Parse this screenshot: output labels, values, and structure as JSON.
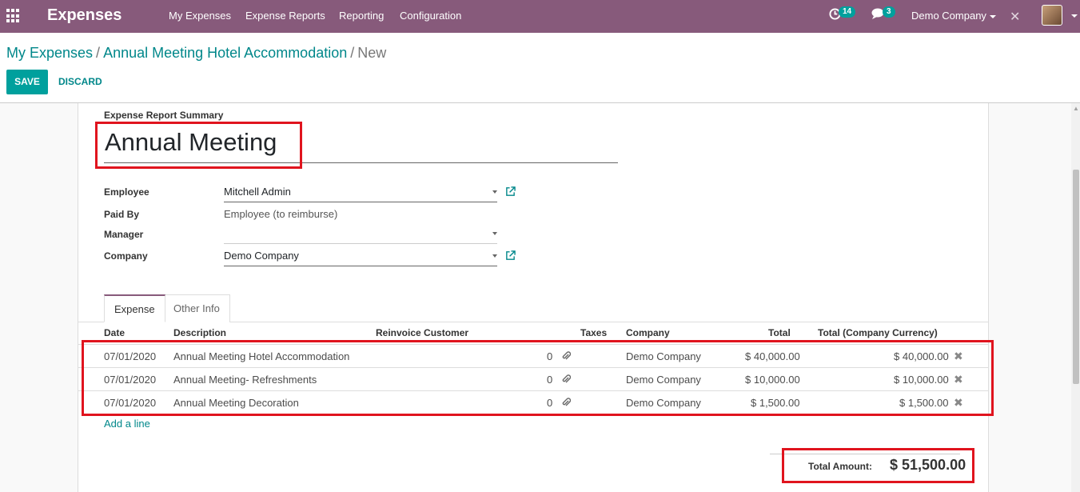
{
  "navbar": {
    "app_title": "Expenses",
    "menu": [
      "My Expenses",
      "Expense Reports",
      "Reporting",
      "Configuration"
    ],
    "activity_count": "14",
    "message_count": "3",
    "company": "Demo Company",
    "icons": [
      "apps-grid-icon",
      "activity-clock-icon",
      "chat-bubble-icon",
      "debug-tools-icon",
      "user-avatar"
    ]
  },
  "breadcrumb": {
    "root": "My Expenses",
    "parent": "Annual Meeting Hotel Accommodation",
    "current": "New",
    "separator": "/"
  },
  "buttons": {
    "save": "SAVE",
    "discard": "DISCARD"
  },
  "form": {
    "summary_label": "Expense Report Summary",
    "summary_value": "Annual Meeting",
    "employee_label": "Employee",
    "employee_value": "Mitchell Admin",
    "paid_by_label": "Paid By",
    "paid_by_value": "Employee (to reimburse)",
    "manager_label": "Manager",
    "manager_value": "",
    "company_label": "Company",
    "company_value": "Demo Company"
  },
  "tabs": [
    "Expense",
    "Other Info"
  ],
  "table": {
    "columns": [
      "Date",
      "Description",
      "Reinvoice Customer",
      "Taxes",
      "Company",
      "Total",
      "Total (Company Currency)"
    ],
    "rows": [
      {
        "date": "07/01/2020",
        "description": "Annual Meeting Hotel Accommodation",
        "attachments": "0",
        "company": "Demo Company",
        "total": "$ 40,000.00",
        "total_company": "$ 40,000.00"
      },
      {
        "date": "07/01/2020",
        "description": "Annual Meeting- Refreshments",
        "attachments": "0",
        "company": "Demo Company",
        "total": "$ 10,000.00",
        "total_company": "$ 10,000.00"
      },
      {
        "date": "07/01/2020",
        "description": "Annual Meeting Decoration",
        "attachments": "0",
        "company": "Demo Company",
        "total": "$ 1,500.00",
        "total_company": "$ 1,500.00"
      }
    ],
    "add_line": "Add a line"
  },
  "totals": {
    "label": "Total Amount:",
    "value": "$ 51,500.00"
  },
  "colors": {
    "brand": "#875a7b",
    "primary": "#00a09d",
    "link": "#00878a",
    "highlight": "#e0141e"
  }
}
